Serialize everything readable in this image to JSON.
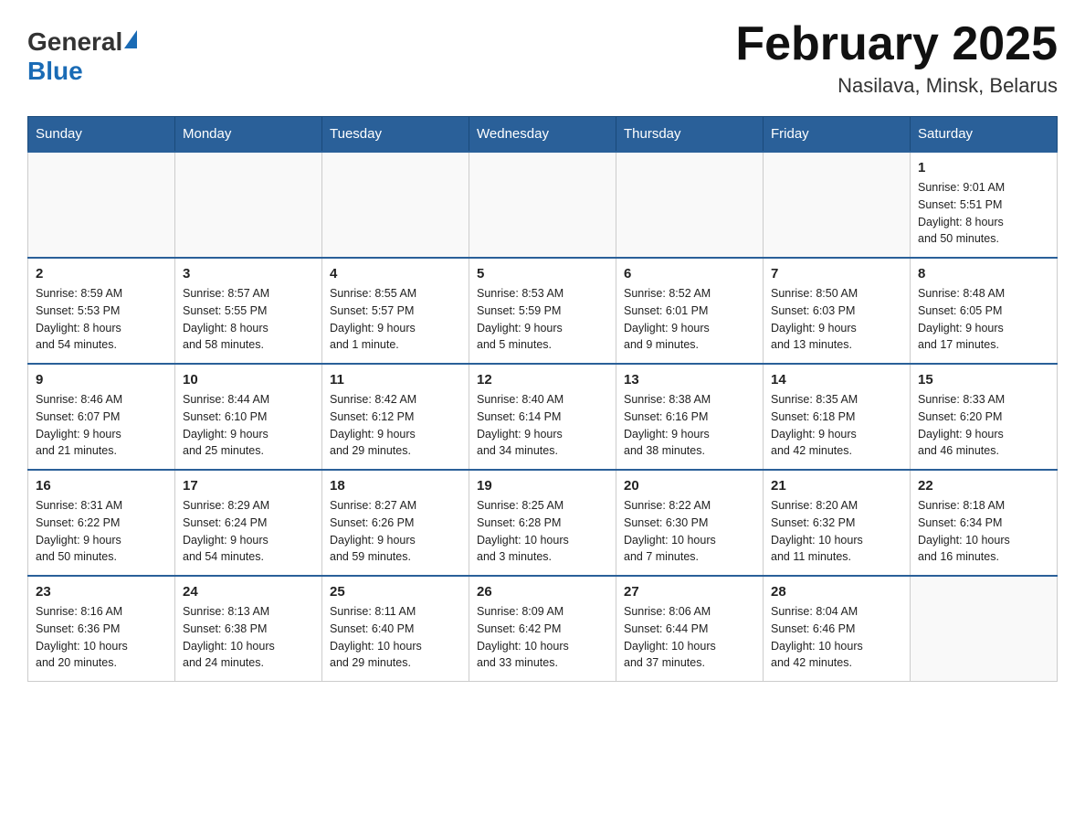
{
  "header": {
    "logo_general": "General",
    "logo_blue": "Blue",
    "month_title": "February 2025",
    "location": "Nasilava, Minsk, Belarus"
  },
  "weekdays": [
    "Sunday",
    "Monday",
    "Tuesday",
    "Wednesday",
    "Thursday",
    "Friday",
    "Saturday"
  ],
  "weeks": [
    [
      {
        "day": "",
        "info": ""
      },
      {
        "day": "",
        "info": ""
      },
      {
        "day": "",
        "info": ""
      },
      {
        "day": "",
        "info": ""
      },
      {
        "day": "",
        "info": ""
      },
      {
        "day": "",
        "info": ""
      },
      {
        "day": "1",
        "info": "Sunrise: 9:01 AM\nSunset: 5:51 PM\nDaylight: 8 hours\nand 50 minutes."
      }
    ],
    [
      {
        "day": "2",
        "info": "Sunrise: 8:59 AM\nSunset: 5:53 PM\nDaylight: 8 hours\nand 54 minutes."
      },
      {
        "day": "3",
        "info": "Sunrise: 8:57 AM\nSunset: 5:55 PM\nDaylight: 8 hours\nand 58 minutes."
      },
      {
        "day": "4",
        "info": "Sunrise: 8:55 AM\nSunset: 5:57 PM\nDaylight: 9 hours\nand 1 minute."
      },
      {
        "day": "5",
        "info": "Sunrise: 8:53 AM\nSunset: 5:59 PM\nDaylight: 9 hours\nand 5 minutes."
      },
      {
        "day": "6",
        "info": "Sunrise: 8:52 AM\nSunset: 6:01 PM\nDaylight: 9 hours\nand 9 minutes."
      },
      {
        "day": "7",
        "info": "Sunrise: 8:50 AM\nSunset: 6:03 PM\nDaylight: 9 hours\nand 13 minutes."
      },
      {
        "day": "8",
        "info": "Sunrise: 8:48 AM\nSunset: 6:05 PM\nDaylight: 9 hours\nand 17 minutes."
      }
    ],
    [
      {
        "day": "9",
        "info": "Sunrise: 8:46 AM\nSunset: 6:07 PM\nDaylight: 9 hours\nand 21 minutes."
      },
      {
        "day": "10",
        "info": "Sunrise: 8:44 AM\nSunset: 6:10 PM\nDaylight: 9 hours\nand 25 minutes."
      },
      {
        "day": "11",
        "info": "Sunrise: 8:42 AM\nSunset: 6:12 PM\nDaylight: 9 hours\nand 29 minutes."
      },
      {
        "day": "12",
        "info": "Sunrise: 8:40 AM\nSunset: 6:14 PM\nDaylight: 9 hours\nand 34 minutes."
      },
      {
        "day": "13",
        "info": "Sunrise: 8:38 AM\nSunset: 6:16 PM\nDaylight: 9 hours\nand 38 minutes."
      },
      {
        "day": "14",
        "info": "Sunrise: 8:35 AM\nSunset: 6:18 PM\nDaylight: 9 hours\nand 42 minutes."
      },
      {
        "day": "15",
        "info": "Sunrise: 8:33 AM\nSunset: 6:20 PM\nDaylight: 9 hours\nand 46 minutes."
      }
    ],
    [
      {
        "day": "16",
        "info": "Sunrise: 8:31 AM\nSunset: 6:22 PM\nDaylight: 9 hours\nand 50 minutes."
      },
      {
        "day": "17",
        "info": "Sunrise: 8:29 AM\nSunset: 6:24 PM\nDaylight: 9 hours\nand 54 minutes."
      },
      {
        "day": "18",
        "info": "Sunrise: 8:27 AM\nSunset: 6:26 PM\nDaylight: 9 hours\nand 59 minutes."
      },
      {
        "day": "19",
        "info": "Sunrise: 8:25 AM\nSunset: 6:28 PM\nDaylight: 10 hours\nand 3 minutes."
      },
      {
        "day": "20",
        "info": "Sunrise: 8:22 AM\nSunset: 6:30 PM\nDaylight: 10 hours\nand 7 minutes."
      },
      {
        "day": "21",
        "info": "Sunrise: 8:20 AM\nSunset: 6:32 PM\nDaylight: 10 hours\nand 11 minutes."
      },
      {
        "day": "22",
        "info": "Sunrise: 8:18 AM\nSunset: 6:34 PM\nDaylight: 10 hours\nand 16 minutes."
      }
    ],
    [
      {
        "day": "23",
        "info": "Sunrise: 8:16 AM\nSunset: 6:36 PM\nDaylight: 10 hours\nand 20 minutes."
      },
      {
        "day": "24",
        "info": "Sunrise: 8:13 AM\nSunset: 6:38 PM\nDaylight: 10 hours\nand 24 minutes."
      },
      {
        "day": "25",
        "info": "Sunrise: 8:11 AM\nSunset: 6:40 PM\nDaylight: 10 hours\nand 29 minutes."
      },
      {
        "day": "26",
        "info": "Sunrise: 8:09 AM\nSunset: 6:42 PM\nDaylight: 10 hours\nand 33 minutes."
      },
      {
        "day": "27",
        "info": "Sunrise: 8:06 AM\nSunset: 6:44 PM\nDaylight: 10 hours\nand 37 minutes."
      },
      {
        "day": "28",
        "info": "Sunrise: 8:04 AM\nSunset: 6:46 PM\nDaylight: 10 hours\nand 42 minutes."
      },
      {
        "day": "",
        "info": ""
      }
    ]
  ]
}
